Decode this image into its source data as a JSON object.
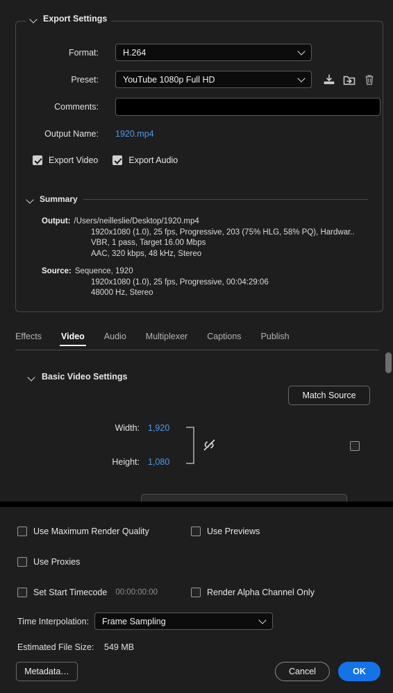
{
  "export_settings": {
    "title": "Export Settings",
    "format": {
      "label": "Format:",
      "value": "H.264"
    },
    "preset": {
      "label": "Preset:",
      "value": "YouTube 1080p Full HD"
    },
    "preset_actions": [
      {
        "name": "save-preset-icon",
        "title": "Save Preset"
      },
      {
        "name": "import-preset-icon",
        "title": "Import Preset"
      },
      {
        "name": "delete-preset-icon",
        "title": "Delete Preset"
      }
    ],
    "comments": {
      "label": "Comments:",
      "value": "",
      "placeholder": ""
    },
    "output_name": {
      "label": "Output Name:",
      "value": "1920.mp4"
    },
    "export_video": {
      "label": "Export Video",
      "checked": true
    },
    "export_audio": {
      "label": "Export Audio",
      "checked": true
    }
  },
  "summary": {
    "title": "Summary",
    "output_key": "Output:",
    "output_lines": [
      "/Users/neilleslie/Desktop/1920.mp4",
      "1920x1080 (1.0), 25 fps, Progressive, 203 (75% HLG, 58% PQ), Hardwar..",
      "VBR, 1 pass, Target 16.00 Mbps",
      "AAC, 320 kbps, 48 kHz, Stereo"
    ],
    "source_key": "Source:",
    "source_lines": [
      "Sequence, 1920",
      "1920x1080 (1.0), 25 fps, Progressive, 00:04:29:06",
      "48000 Hz, Stereo"
    ]
  },
  "tabs": [
    {
      "label": "Effects",
      "active": false
    },
    {
      "label": "Video",
      "active": true
    },
    {
      "label": "Audio",
      "active": false
    },
    {
      "label": "Multiplexer",
      "active": false
    },
    {
      "label": "Captions",
      "active": false
    },
    {
      "label": "Publish",
      "active": false
    }
  ],
  "video_tab": {
    "section_title": "Basic Video Settings",
    "match_source_label": "Match Source",
    "width": {
      "label": "Width:",
      "value": "1,920"
    },
    "height": {
      "label": "Height:",
      "value": "1,080"
    },
    "link_icon": "broken-link-icon",
    "aspect_checkbox": {
      "checked": false
    }
  },
  "bottom_options": {
    "max_render_quality": {
      "label": "Use Maximum Render Quality",
      "checked": false
    },
    "use_previews": {
      "label": "Use Previews",
      "checked": false
    },
    "use_proxies": {
      "label": "Use Proxies",
      "checked": false
    },
    "set_start_timecode": {
      "label": "Set Start Timecode",
      "checked": false,
      "value": "00:00:00:00"
    },
    "render_alpha_only": {
      "label": "Render Alpha Channel Only",
      "checked": false
    },
    "time_interpolation": {
      "label": "Time Interpolation:",
      "value": "Frame Sampling"
    },
    "estimated_file_size": {
      "label": "Estimated File Size:",
      "value": "549 MB"
    }
  },
  "footer": {
    "metadata_label": "Metadata…",
    "cancel_label": "Cancel",
    "ok_label": "OK"
  },
  "colors": {
    "background": "#1e1e1e",
    "accent_blue": "#1473e6",
    "link_blue": "#4d9bf5",
    "field_black": "#0c0c0c",
    "border": "#4a4a4a"
  }
}
